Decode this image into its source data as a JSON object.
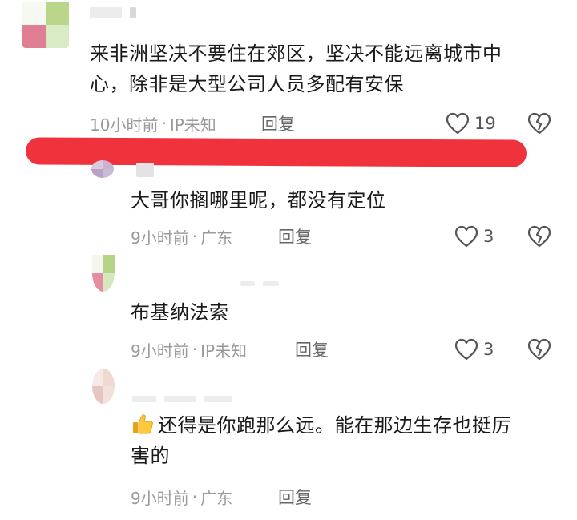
{
  "comments": [
    {
      "text_lines": [
        "来非洲坚决不要住在郊区，坚决不能远离城市中",
        "心，除非是大型公司人员多配有安保"
      ],
      "time": "10小时前",
      "location": "IP未知",
      "reply_label": "回复",
      "likes": "19"
    },
    {
      "text_lines": [
        "大哥你搁哪里呢，都没有定位"
      ],
      "time": "9小时前",
      "location": "广东",
      "reply_label": "回复",
      "likes": "3"
    },
    {
      "text_lines": [
        "布基纳法索"
      ],
      "time": "9小时前",
      "location": "IP未知",
      "reply_label": "回复",
      "likes": "3"
    },
    {
      "text_lines": [
        "还得是你跑那么远。能在那边生存也挺厉",
        "害的"
      ],
      "time": "9小时前",
      "location": "广东",
      "reply_label": "回复",
      "likes": ""
    }
  ],
  "colors": {
    "annotation_red": "#f0323c",
    "meta_gray": "#9a9a9a",
    "text": "#1a1a1a"
  },
  "icons": {
    "like": "heart-outline-icon",
    "dislike": "broken-heart-icon",
    "emoji": "thumbs-up-emoji-icon"
  }
}
